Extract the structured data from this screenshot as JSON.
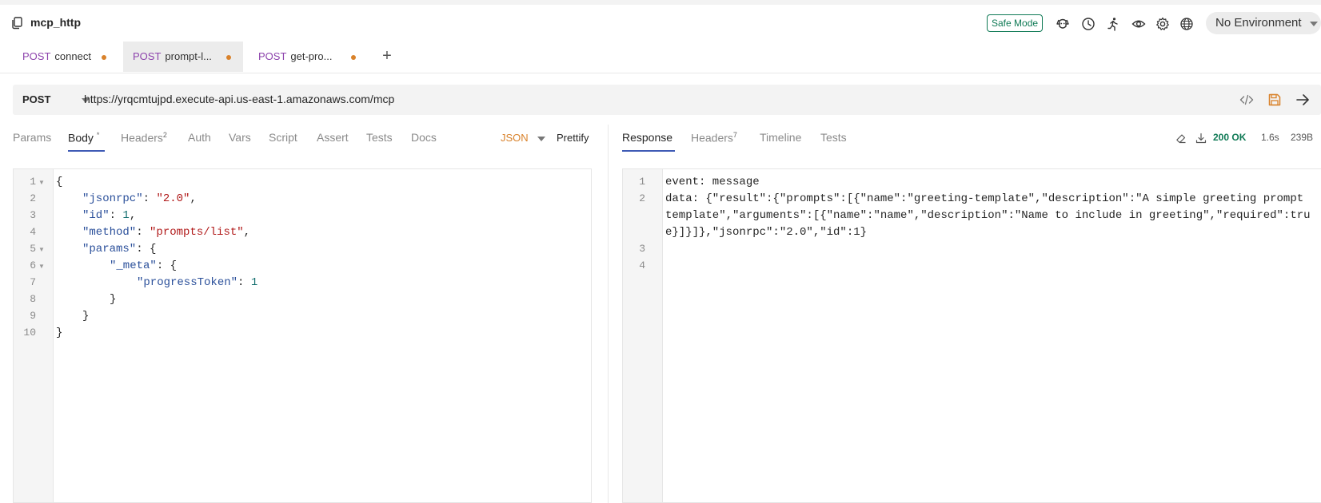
{
  "header": {
    "collection_title": "mcp_http",
    "safe_mode_label": "Safe Mode",
    "environment_label": "No Environment",
    "icons": [
      "copy-icon",
      "dog-icon",
      "clock-icon",
      "runner-icon",
      "eye-icon",
      "gear-icon",
      "globe-icon"
    ]
  },
  "tabs": [
    {
      "method": "POST",
      "name": "connect",
      "unsaved": true,
      "active": false
    },
    {
      "method": "POST",
      "name": "prompt-l...",
      "unsaved": true,
      "active": true
    },
    {
      "method": "POST",
      "name": "get-pro...",
      "unsaved": true,
      "active": false
    }
  ],
  "new_tab_label": "+",
  "request": {
    "method": "POST",
    "url": "https://yrqcmtujpd.execute-api.us-east-1.amazonaws.com/mcp"
  },
  "request_tabs": {
    "params": "Params",
    "body": "Body",
    "body_marker": "*",
    "headers": "Headers",
    "headers_count": "2",
    "auth": "Auth",
    "vars": "Vars",
    "script": "Script",
    "assert": "Assert",
    "tests": "Tests",
    "docs": "Docs",
    "body_mode": "JSON",
    "prettify": "Prettify"
  },
  "response_tabs": {
    "response": "Response",
    "headers": "Headers",
    "headers_count": "7",
    "timeline": "Timeline",
    "tests": "Tests"
  },
  "response_status": {
    "status": "200 OK",
    "time": "1.6s",
    "size": "239B"
  },
  "request_body": {
    "line_numbers": [
      "1",
      "2",
      "3",
      "4",
      "5",
      "6",
      "7",
      "8",
      "9",
      "10"
    ],
    "l1": "{",
    "l2_key": "\"jsonrpc\"",
    "l2_val": "\"2.0\"",
    "l3_key": "\"id\"",
    "l3_val": "1",
    "l4_key": "\"method\"",
    "l4_val": "\"prompts/list\"",
    "l5_key": "\"params\"",
    "l5_open": "{",
    "l6_key": "\"_meta\"",
    "l6_open": "{",
    "l7_key": "\"progressToken\"",
    "l7_val": "1",
    "l8": "}",
    "l9": "}",
    "l10": "}"
  },
  "response_body": {
    "line_numbers": [
      "1",
      "2",
      "3",
      "4"
    ],
    "l1": "event: message",
    "l2a": "data: {\"result\":{\"prompts\":[{\"name\":\"greeting-template\",\"description\":\"A simple greeting prompt",
    "l2b": "template\",\"arguments\":[{\"name\":\"name\",\"description\":\"Name to include in greeting\",\"required\":tru",
    "l2c": "e}]}]},\"jsonrpc\":\"2.0\",\"id\":1}"
  },
  "colors": {
    "method_purple": "#8e44ad",
    "unsaved_dot": "#d9822b",
    "status_green": "#0f7a55",
    "active_tab_underline": "#3f5bb5",
    "json_key": "#2a4f9a",
    "json_string": "#b11a1a",
    "json_number": "#126e6e"
  }
}
